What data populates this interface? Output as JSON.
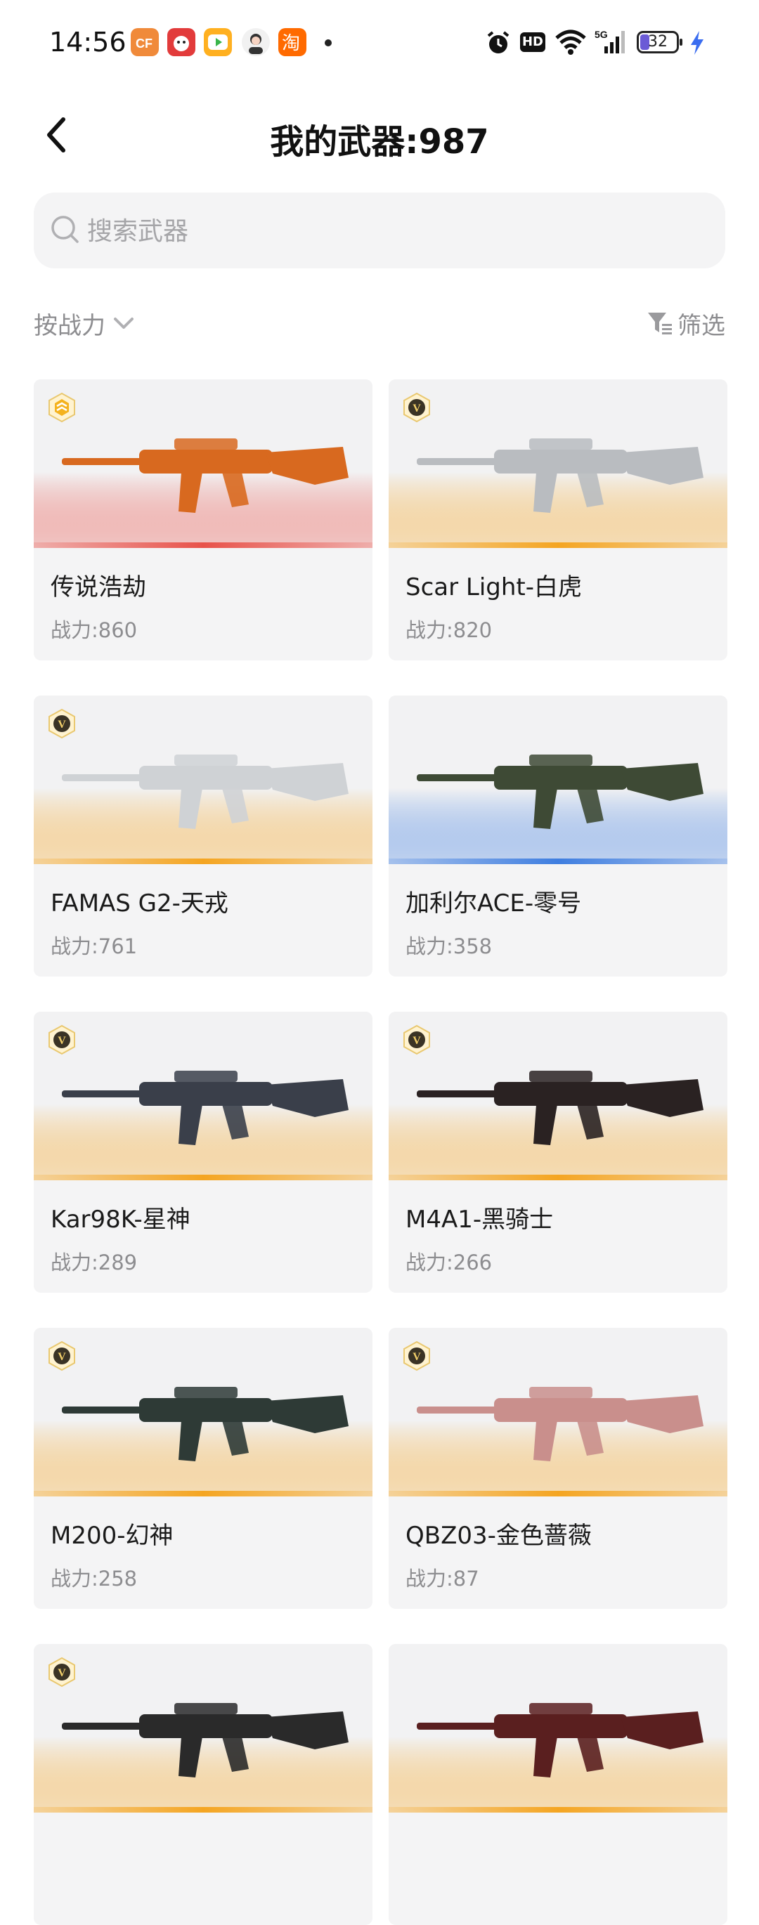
{
  "status_bar": {
    "time": "14:56",
    "network": "5G",
    "battery": "32",
    "hd": "HD",
    "notification_icons": [
      "cf-app-icon",
      "cartoon-app-icon",
      "video-app-icon",
      "avatar-app-icon",
      "taobao-app-icon"
    ],
    "taobao_char": "淘"
  },
  "header": {
    "title": "我的武器:987"
  },
  "search": {
    "placeholder": "搜索武器",
    "value": ""
  },
  "toolbar": {
    "sort_label": "按战力",
    "filter_label": "筛选"
  },
  "weapons": [
    {
      "name": "传说浩劫",
      "power": "战力:860",
      "tier_color": "#e8524a",
      "badge": "legendary-badge-icon",
      "gun_color": "#d8691f"
    },
    {
      "name": "Scar Light-白虎",
      "power": "战力:820",
      "tier_color": "#f4a522",
      "badge": "v-badge-icon",
      "gun_color": "#b9bcc0"
    },
    {
      "name": "FAMAS G2-天戎",
      "power": "战力:761",
      "tier_color": "#f4a522",
      "badge": "v-badge-icon",
      "gun_color": "#cfd2d5"
    },
    {
      "name": "加利尔ACE-零号",
      "power": "战力:358",
      "tier_color": "#3f7ee0",
      "badge": "",
      "gun_color": "#3e4a35"
    },
    {
      "name": "Kar98K-星神",
      "power": "战力:289",
      "tier_color": "#f4a522",
      "badge": "v-badge-icon",
      "gun_color": "#3a3f4a"
    },
    {
      "name": "M4A1-黑骑士",
      "power": "战力:266",
      "tier_color": "#f4a522",
      "badge": "v-badge-icon",
      "gun_color": "#2a2222"
    },
    {
      "name": "M200-幻神",
      "power": "战力:258",
      "tier_color": "#f4a522",
      "badge": "v-badge-icon",
      "gun_color": "#2e3a36"
    },
    {
      "name": "QBZ03-金色蔷薇",
      "power": "战力:87",
      "tier_color": "#f4a522",
      "badge": "v-badge-icon",
      "gun_color": "#c98f8c"
    },
    {
      "name": "",
      "power": "",
      "tier_color": "#f4a522",
      "badge": "v-badge-icon",
      "gun_color": "#2a2a2a"
    },
    {
      "name": "",
      "power": "",
      "tier_color": "#f4a522",
      "badge": "",
      "gun_color": "#5a1f1f"
    }
  ]
}
